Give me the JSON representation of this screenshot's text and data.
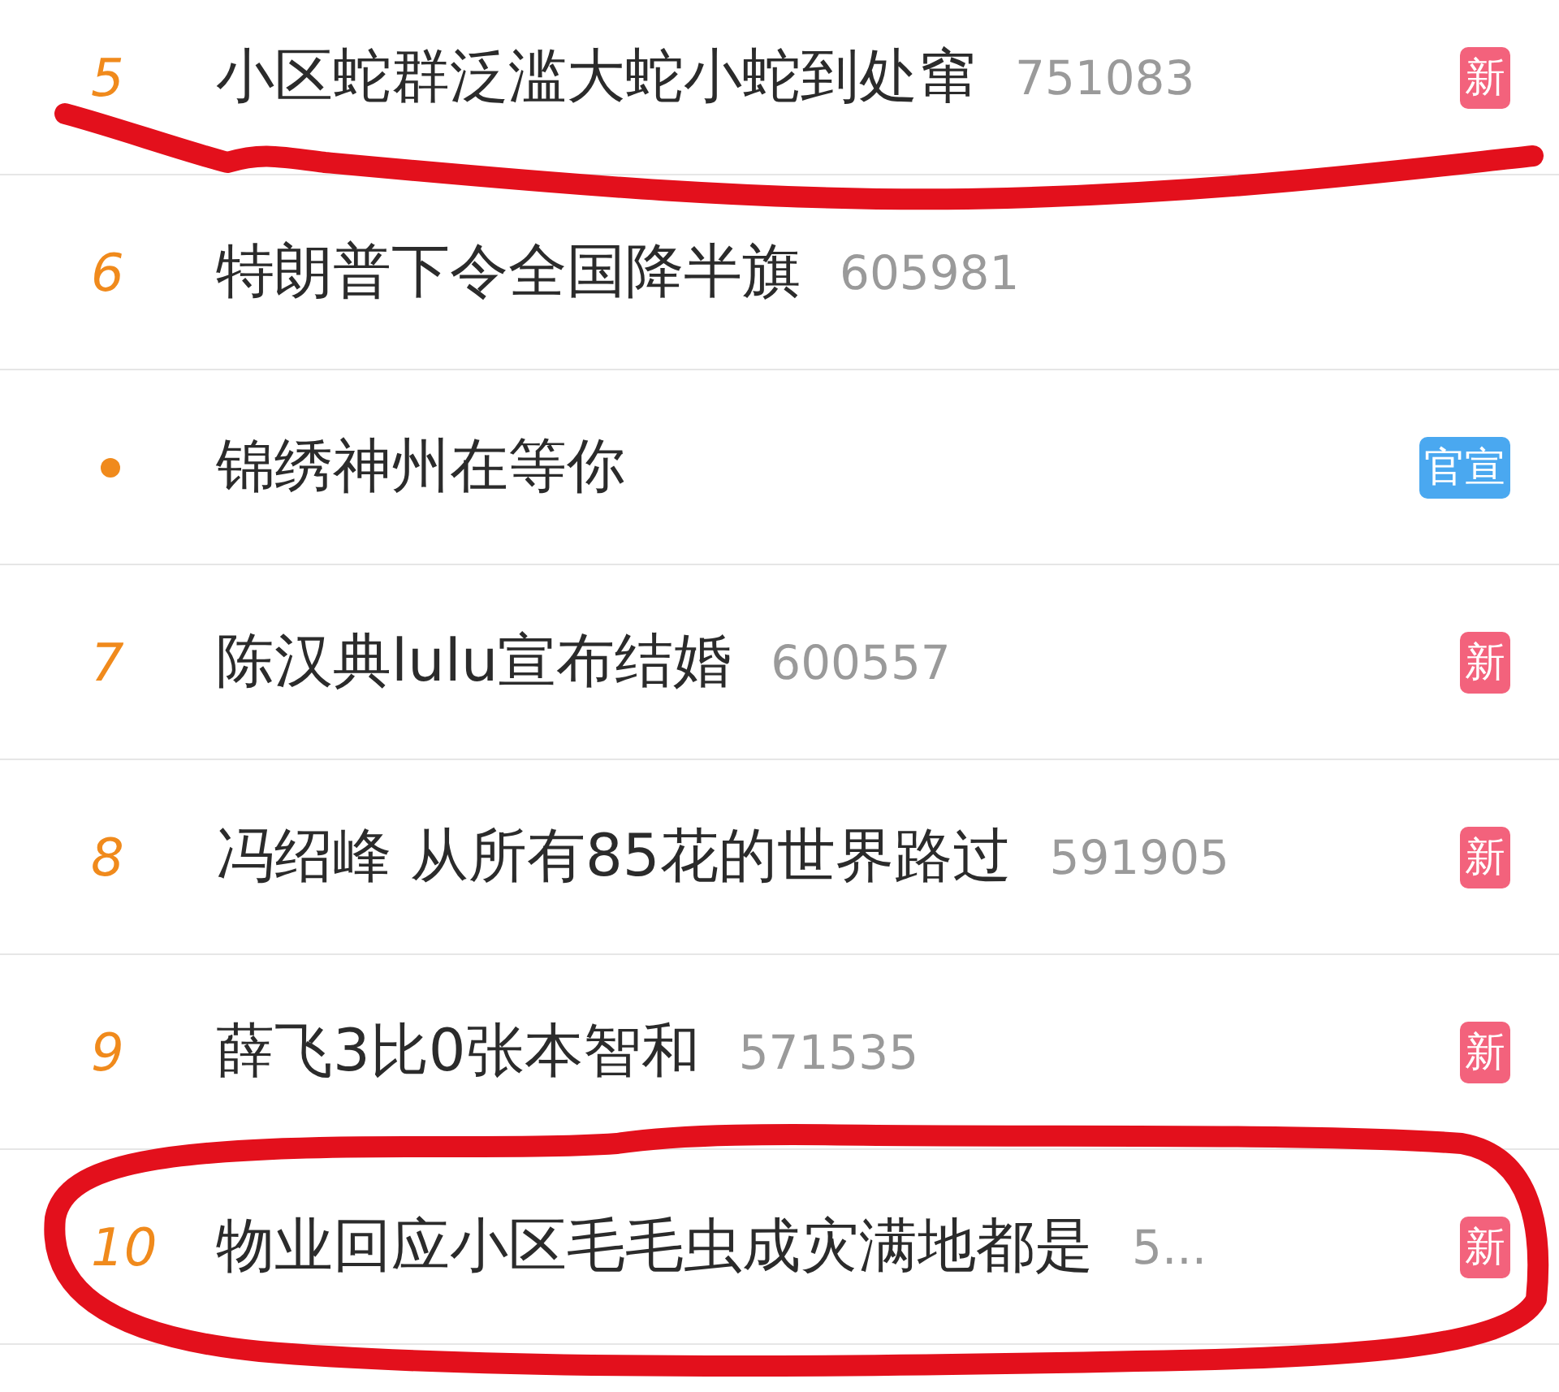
{
  "hot_list": [
    {
      "rank": {
        "kind": "number",
        "text": "5"
      },
      "title": "小区蛇群泛滥大蛇小蛇到处窜",
      "count": "751083",
      "badge": {
        "kind": "new",
        "text": "新"
      }
    },
    {
      "rank": {
        "kind": "number",
        "text": "6"
      },
      "title": "特朗普下令全国降半旗",
      "count": "605981"
    },
    {
      "rank": {
        "kind": "dot"
      },
      "title": "锦绣神州在等你",
      "badge": {
        "kind": "promo",
        "text": "官宣"
      }
    },
    {
      "rank": {
        "kind": "number",
        "text": "7"
      },
      "title": "陈汉典lulu宣布结婚",
      "count": "600557",
      "badge": {
        "kind": "new",
        "text": "新"
      }
    },
    {
      "rank": {
        "kind": "number",
        "text": "8"
      },
      "title": "冯绍峰 从所有85花的世界路过",
      "count": "591905",
      "badge": {
        "kind": "new",
        "text": "新"
      }
    },
    {
      "rank": {
        "kind": "number",
        "text": "9"
      },
      "title": "薛飞3比0张本智和",
      "count": "571535",
      "badge": {
        "kind": "new",
        "text": "新"
      }
    },
    {
      "rank": {
        "kind": "number",
        "text": "10"
      },
      "title": "物业回应小区毛毛虫成灾满地都是",
      "count": "5...",
      "badge": {
        "kind": "new",
        "text": "新"
      }
    }
  ]
}
